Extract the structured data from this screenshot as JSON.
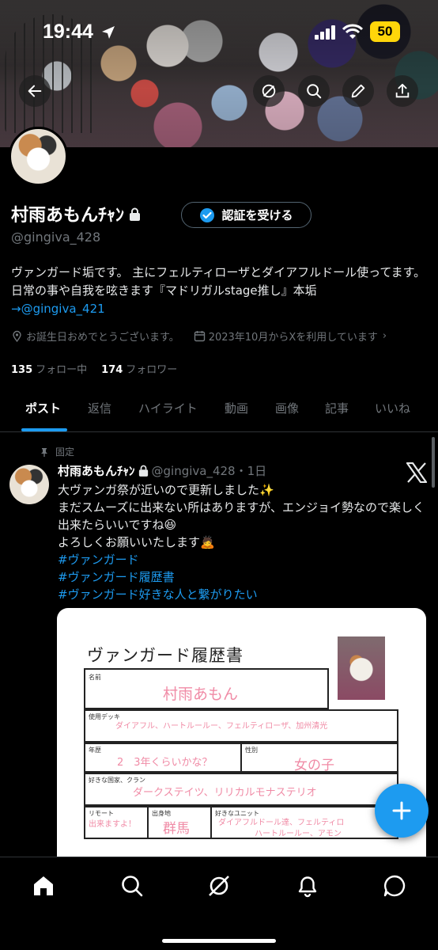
{
  "status_bar": {
    "time": "19:44",
    "battery": "50"
  },
  "profile": {
    "display_name": "村雨あもんﾁｬﾝ",
    "verify_button": "認証を受ける",
    "handle": "@gingiva_428",
    "bio_line1": "ヴァンガード垢です。 主にフェルティローザとダイアフルドール使ってます。日常の事や自我を呟きます『マドリガルstage推し』本垢",
    "bio_link": "→@gingiva_421",
    "birthday": "お誕生日おめでとうございます。",
    "joined": "2023年10月からXを利用しています",
    "following_count": "135",
    "following_label": "フォロー中",
    "followers_count": "174",
    "followers_label": "フォロワー"
  },
  "tabs": [
    "ポスト",
    "返信",
    "ハイライト",
    "動画",
    "画像",
    "記事",
    "いいね"
  ],
  "post": {
    "pinned_label": "固定",
    "author": "村雨あもんﾁｬﾝ",
    "handle_time": "@gingiva_428・1日",
    "line1": "大ヴァンガ祭が近いので更新しました✨",
    "line2": "まだスムーズに出来ない所はありますが、エンジョイ勢なので楽しく出来たらいいですね😆",
    "line3": "よろしくお願いいたします🙇",
    "tags": [
      "#ヴァンガード",
      "#ヴァンガード履歴書",
      "#ヴァンガード好きな人と繋がりたい"
    ]
  },
  "resume_card": {
    "title": "ヴァンガード履歴書",
    "name_label": "名前",
    "name_value": "村雨あもん",
    "deck_label": "使用デッキ",
    "deck_value": "ダイアフル、ハートルールー、フェルティローザ、加州清光",
    "history_label": "年歴",
    "history_value": "2　3年くらいかな？",
    "gender_label": "性別",
    "gender_value": "女の子",
    "nation_label": "好きな国家、クラン",
    "nation_value": "ダークステイツ、リリカルモナステリオ",
    "remote_label": "リモート",
    "remote_value": "出来ますよ！",
    "origin_label": "出身地",
    "origin_value": "群馬",
    "unit_label": "好きなユニット",
    "unit_value_1": "ダイアフルドール達、フェルティロ",
    "unit_value_2": "ハートルールー、アモン"
  },
  "colors": {
    "accent": "#1d9bf0",
    "background": "#000000",
    "secondary_text": "#71767b",
    "pink_handwriting": "#f08ba6"
  },
  "icons": [
    "back-arrow-icon",
    "no-sign-icon",
    "search-icon",
    "edit-pencil-icon",
    "share-icon",
    "lock-icon",
    "verified-badge-icon",
    "location-icon",
    "calendar-icon",
    "pin-icon",
    "x-logo-icon",
    "compose-plus-icon",
    "home-icon",
    "explore-search-icon",
    "grok-icon",
    "notifications-bell-icon",
    "messages-icon"
  ]
}
